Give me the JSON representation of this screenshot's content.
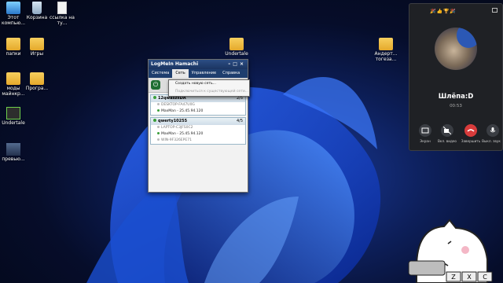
{
  "desktop": {
    "icons": [
      {
        "label": "Этот компью...",
        "type": "pc"
      },
      {
        "label": "Корзина",
        "type": "bin"
      },
      {
        "label": "ссылка на ту...",
        "type": "doc"
      },
      {
        "label": "папки",
        "type": "folder"
      },
      {
        "label": "Игры",
        "type": "folder"
      },
      {
        "label": "моды майнкр...",
        "type": "folder"
      },
      {
        "label": "Програ...",
        "type": "folder"
      },
      {
        "label": "Undertale",
        "type": "game"
      },
      {
        "label": "превью...",
        "type": "pics"
      },
      {
        "label": "Undertale",
        "type": "folder"
      },
      {
        "label": "Андерт... тогеза...",
        "type": "folder"
      }
    ]
  },
  "hamachi": {
    "title": "LogMeIn Hamachi",
    "menu": [
      "Система",
      "Сеть",
      "Управление",
      "Справка"
    ],
    "active_menu": "Сеть",
    "dropdown": {
      "items": [
        {
          "label": "Создать новую сеть...",
          "enabled": true
        },
        {
          "label": "Подключиться к существующей сети...",
          "enabled": false
        }
      ]
    },
    "networks": [
      {
        "name": "12qwaszxDA",
        "count": "2/5",
        "peers": [
          {
            "label": "DESKTOP-FA47U0G",
            "online": false
          },
          {
            "label": "MaxMan - 25.45.94.120",
            "online": true
          }
        ]
      },
      {
        "name": "qwerty10255",
        "count": "4/5",
        "peers": [
          {
            "label": "LAPTOP-C3JFS0C2",
            "online": false
          },
          {
            "label": "MaxMan - 25.45.94.120",
            "online": true
          },
          {
            "label": "WIN-9F326EPE71",
            "online": false
          }
        ]
      }
    ]
  },
  "call": {
    "top_icons": "🎉👍🏆🎉",
    "name": "Шлёпа:D",
    "time": "00:53",
    "buttons": [
      {
        "label": "Экран",
        "icon": "screen-share-icon"
      },
      {
        "label": "Вкл. видео",
        "icon": "video-off-icon"
      },
      {
        "label": "Завершить",
        "icon": "hangup-icon"
      },
      {
        "label": "Выкл. звук",
        "icon": "mic-icon"
      }
    ],
    "colors": {
      "hangup": "#d83b3b",
      "panel": "#1f2125"
    }
  },
  "bongo": {
    "keys": [
      "Z",
      "X",
      "C"
    ]
  }
}
